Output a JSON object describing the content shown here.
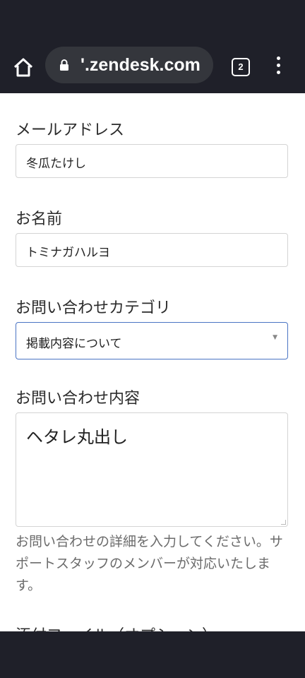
{
  "browser": {
    "url": "'.zendesk.com",
    "tab_count": "2"
  },
  "form": {
    "email_label": "メールアドレス",
    "email_value": "冬瓜たけし",
    "name_label": "お名前",
    "name_value": "トミナガハルヨ",
    "category_label": "お問い合わせカテゴリ",
    "category_value": "掲載内容について",
    "message_label": "お問い合わせ内容",
    "message_value": "ヘタレ丸出し",
    "message_help": "お問い合わせの詳細を入力してください。サポートスタッフのメンバーが対応いたします。",
    "attachment_label": "添付ファイル（オプション）"
  },
  "colors": {
    "chrome_bg": "#1f2029",
    "urlbar_bg": "#34363c",
    "focus_border": "#4a74c4"
  }
}
